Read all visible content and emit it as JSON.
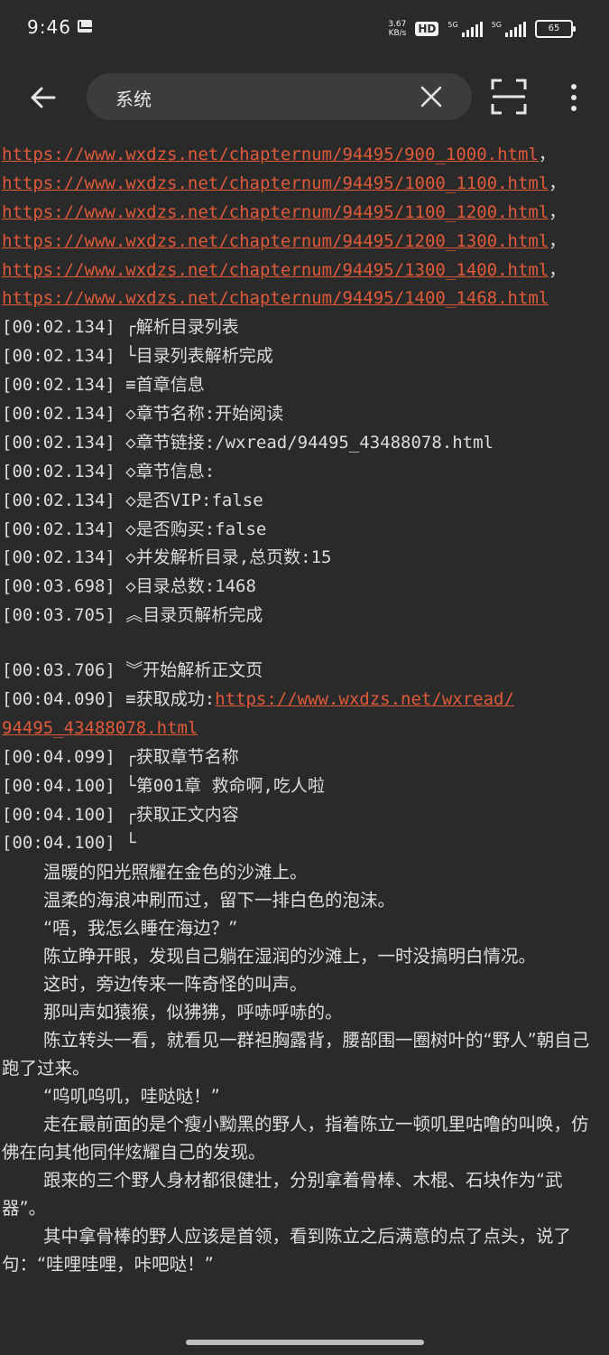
{
  "status_bar": {
    "time": "9:46",
    "speed_value": "3.67",
    "speed_unit": "KB/s",
    "hd_label": "HD",
    "sig1_label": "5G",
    "sig2_label": "5G",
    "battery": "65"
  },
  "toolbar": {
    "search_value": "系统"
  },
  "log": {
    "lines": [
      {
        "text": "",
        "link": "https://www.wxdzs.net/chapternum/94495/900_1000.html",
        "suffix": "，"
      },
      {
        "text": "",
        "link": "https://www.wxdzs.net/chapternum/94495/1000_1100.html",
        "suffix": "，"
      },
      {
        "text": "",
        "link": "https://www.wxdzs.net/chapternum/94495/1100_1200.html",
        "suffix": "，"
      },
      {
        "text": "",
        "link": "https://www.wxdzs.net/chapternum/94495/1200_1300.html",
        "suffix": "，"
      },
      {
        "text": "",
        "link": "https://www.wxdzs.net/chapternum/94495/1300_1400.html",
        "suffix": "，"
      },
      {
        "text": "",
        "link": "https://www.wxdzs.net/chapternum/94495/1400_1468.html",
        "suffix": ""
      },
      {
        "text": "[00:02.134] ┌解析目录列表"
      },
      {
        "text": "[00:02.134] └目录列表解析完成"
      },
      {
        "text": "[00:02.134] ≡首章信息"
      },
      {
        "text": "[00:02.134] ◇章节名称:开始阅读"
      },
      {
        "text": "[00:02.134] ◇章节链接:/wxread/94495_43488078.html"
      },
      {
        "text": "[00:02.134] ◇章节信息:"
      },
      {
        "text": "[00:02.134] ◇是否VIP:false"
      },
      {
        "text": "[00:02.134] ◇是否购买:false"
      },
      {
        "text": "[00:02.134] ◇并发解析目录,总页数:15"
      },
      {
        "text": "[00:03.698] ◇目录总数:1468"
      },
      {
        "text": "[00:03.705] ︽目录页解析完成"
      }
    ],
    "lines2": [
      {
        "text": "[00:03.706] ︾开始解析正文页"
      },
      {
        "text": "[00:04.090] ≡获取成功:",
        "link": "https://www.wxdzs.net/wxread/"
      },
      {
        "text": "",
        "link": "94495_43488078.html"
      },
      {
        "text": "[00:04.099] ┌获取章节名称"
      },
      {
        "text": "[00:04.100] └第001章 救命啊,吃人啦"
      },
      {
        "text": "[00:04.100] ┌获取正文内容"
      },
      {
        "text": "[00:04.100] └"
      }
    ],
    "paragraphs": [
      "温暖的阳光照耀在金色的沙滩上。",
      "温柔的海浪冲刷而过，留下一排白色的泡沫。",
      "“唔，我怎么睡在海边？”",
      "陈立睁开眼，发现自己躺在湿润的沙滩上，一时没搞明白情况。",
      "这时，旁边传来一阵奇怪的叫声。",
      "那叫声如猿猴，似狒狒，呼哧呼哧的。",
      "陈立转头一看，就看见一群袒胸露背，腰部围一圈树叶的“野人”朝自己跑了过来。",
      "“呜叽呜叽，哇哒哒！”",
      "走在最前面的是个瘦小黝黑的野人，指着陈立一顿叽里咕噜的叫唤，仿佛在向其他同伴炫耀自己的发现。",
      "跟来的三个野人身材都很健壮，分别拿着骨棒、木棍、石块作为“武器”。",
      "其中拿骨棒的野人应该是首领，看到陈立之后满意的点了点头，说了句：“哇哩哇哩，咔吧哒！”"
    ]
  }
}
